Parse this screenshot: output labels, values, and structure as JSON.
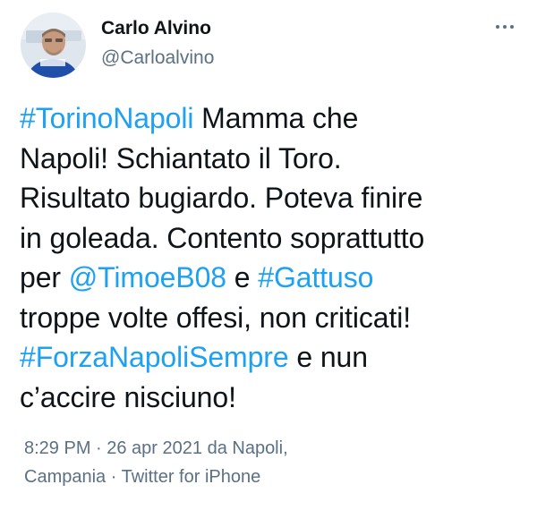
{
  "author": {
    "name": "Carlo Alvino",
    "handle": "@Carloalvino"
  },
  "menu_icon": "more-horizontal-icon",
  "tweet": {
    "lines": [
      [
        {
          "text": "#TorinoNapoli",
          "link": true
        },
        {
          "text": " Mamma che",
          "link": false
        }
      ],
      [
        {
          "text": "Napoli! Schiantato il Toro.",
          "link": false
        }
      ],
      [
        {
          "text": "Risultato bugiardo. Poteva finire",
          "link": false
        }
      ],
      [
        {
          "text": "in goleada. Contento soprattutto",
          "link": false
        }
      ],
      [
        {
          "text": "per ",
          "link": false
        },
        {
          "text": "@TimoeB08",
          "link": true
        },
        {
          "text": " e ",
          "link": false
        },
        {
          "text": "#Gattuso",
          "link": true
        }
      ],
      [
        {
          "text": "troppe volte offesi, non criticati!",
          "link": false
        }
      ],
      [
        {
          "text": "#ForzaNapoliSempre",
          "link": true
        },
        {
          "text": " e nun",
          "link": false
        }
      ],
      [
        {
          "text": "c’accire nisciuno!",
          "link": false
        }
      ]
    ]
  },
  "meta": {
    "line1": "8:29 PM · 26 apr 2021 da Napoli,",
    "location_cont": "Campania",
    "separator": " · ",
    "source": "Twitter for iPhone"
  },
  "colors": {
    "link": "#1da1f2",
    "secondary_text": "#5b7083",
    "primary_text": "#0f1419"
  }
}
